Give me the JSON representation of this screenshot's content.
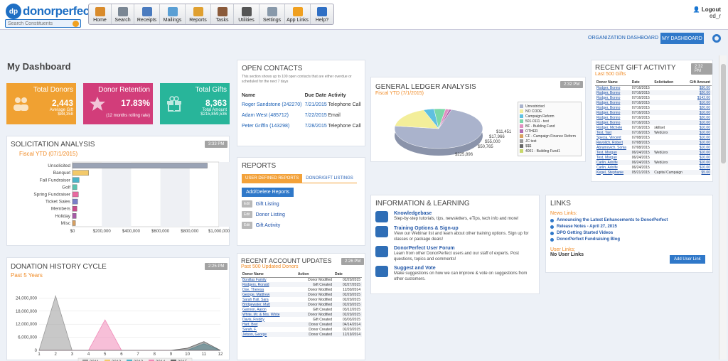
{
  "app": {
    "logo_badge": "dp",
    "logo_text": "donorperfect",
    "search_placeholder": "Search Constituents"
  },
  "nav": [
    {
      "label": "Home",
      "icon": "home-icon",
      "color": "#d98b2b"
    },
    {
      "label": "Search",
      "icon": "search-icon",
      "color": "#7b8794"
    },
    {
      "label": "Receipts",
      "icon": "receipts-icon",
      "color": "#4a7bbf"
    },
    {
      "label": "Mailings",
      "icon": "mailings-icon",
      "color": "#5a9fd4"
    },
    {
      "label": "Reports",
      "icon": "reports-icon",
      "color": "#e0a030"
    },
    {
      "label": "Tasks",
      "icon": "tasks-icon",
      "color": "#8a5a3a"
    },
    {
      "label": "Utilities",
      "icon": "utilities-icon",
      "color": "#555555"
    },
    {
      "label": "Settings",
      "icon": "settings-icon",
      "color": "#8899aa"
    },
    {
      "label": "App Links",
      "icon": "app-links-icon",
      "color": "#f0a020"
    },
    {
      "label": "Help?",
      "icon": "help-icon",
      "color": "#2f6fc4"
    }
  ],
  "user": {
    "logout": "Logout",
    "name": "ed_r"
  },
  "header": {
    "org_dashboard": "ORGANIZATION DASHBOARD",
    "my_dashboard": "MY DASHBOARD",
    "title": "My Dashboard"
  },
  "kpis": [
    {
      "title": "Total Donors",
      "value": "2,443",
      "sub1": "Average Gift",
      "sub2": "$88,358",
      "color": "#f0a132"
    },
    {
      "title": "Donor Retention",
      "value": "17.83%",
      "sub1": "(12 months rolling rate)",
      "sub2": "",
      "color": "#d23d7a"
    },
    {
      "title": "Total Gifts",
      "value": "8,363",
      "sub1": "Total Amount",
      "sub2": "$215,859,536",
      "color": "#28b59a"
    }
  ],
  "solicitation": {
    "title": "SOLICITATION ANALYSIS",
    "subtitle": "Fiscal YTD (07/1/2015)",
    "time": "3:33 PM"
  },
  "donation_history": {
    "title": "DONATION HISTORY CYCLE",
    "subtitle": "Past 5 Years",
    "time": "2:25 PM"
  },
  "open_contacts": {
    "title": "OPEN CONTACTS",
    "desc": "This section shows up to 100 open contacts that are either overdue or scheduled for the next 7 days",
    "headers": [
      "Name",
      "Due Date",
      "Activity"
    ],
    "rows": [
      {
        "name": "Roger Sandstone (242270)",
        "due": "7/21/2015",
        "activity": "Telephone Call"
      },
      {
        "name": "Adam West (485712)",
        "due": "7/22/2015",
        "activity": "Email"
      },
      {
        "name": "Peter Griffin (143298)",
        "due": "7/28/2015",
        "activity": "Telephone Call"
      }
    ]
  },
  "reports": {
    "title": "REPORTS",
    "tab1": "USER DEFINED REPORTS",
    "tab2": "DONOR/GIFT LISTINGS",
    "button": "Add/Delete Reports",
    "edit": "Edit",
    "links": [
      "Gift Listing",
      "Donor Listing",
      "Gift Activity"
    ]
  },
  "account_updates": {
    "title": "RECENT ACCOUNT UPDATES",
    "subtitle": "Past 500 Updated Donors",
    "time": "2:26 PM",
    "headers": [
      "Donor Name",
      "Action",
      "Date"
    ],
    "rows": [
      [
        "Bonillas Family",
        "Donor Modified",
        "02/20/2015"
      ],
      [
        "Rodgers, Ronald",
        "Gift Created",
        "02/27/2015"
      ],
      [
        "Doe, Theresa",
        "Donor Modified",
        "12/30/2014"
      ],
      [
        "George, Matthew",
        "Donor Modified",
        "02/20/2015"
      ],
      [
        "Sarah Hall, Sara",
        "Donor Modified",
        "02/20/2015"
      ],
      [
        "Bridgewater, Matt",
        "Donor Modified",
        "02/20/2015"
      ],
      [
        "Gannon, Aaron",
        "Gift Created",
        "03/12/2015"
      ],
      [
        "White, Mr. & Mrs. White",
        "Donor Modified",
        "02/20/2015"
      ],
      [
        "Davis, Freddy",
        "Gift Created",
        "03/03/2015"
      ],
      [
        "Hart, Bret",
        "Donor Created",
        "04/14/2014"
      ],
      [
        "Sarah, F.",
        "Donor Created",
        "02/20/2015"
      ],
      [
        "Jetson, George",
        "Donor Created",
        "12/19/2014"
      ]
    ]
  },
  "general_ledger": {
    "title": "GENERAL LEDGER ANALYSIS",
    "subtitle": "Fiscal YTD (7/1/2015)",
    "time": "2:32 PM",
    "labels": [
      "$944,723",
      "$11,451",
      "$17,966",
      "$55,000",
      "$50,765",
      "$225,896"
    ],
    "legend": [
      "Unrestricted",
      "NO CODE",
      "Campaign Reform",
      "501-0111 - test",
      "BF - Building Fund",
      "OTHER",
      "CF - Campaign Finance Reform",
      "JC test",
      "$$$",
      "4001 - Building Fund1"
    ]
  },
  "gift_activity": {
    "title": "RECENT GIFT ACTIVITY",
    "subtitle": "Last 500 Gifts",
    "time": "2:32 PM",
    "headers": [
      "Donor Name",
      "Date",
      "Solicitation",
      "Gift Amount"
    ],
    "rows": [
      [
        "Rodger, Bonno",
        "07/16/2015",
        "",
        "$30.00"
      ],
      [
        "Rodger, Bonno",
        "07/16/2015",
        "",
        "$20.00"
      ],
      [
        "Rodger, Bonno",
        "07/16/2015",
        "",
        "$142.00"
      ],
      [
        "Rodger, Bonno",
        "07/16/2015",
        "",
        "$10.00"
      ],
      [
        "Rodger, Bonno",
        "07/16/2015",
        "",
        "$20.00"
      ],
      [
        "Rodger, Bonno",
        "07/16/2015",
        "",
        "$10.00"
      ],
      [
        "Rodger, Bonno",
        "07/16/2015",
        "",
        "$20.00"
      ],
      [
        "Rodger, Bonno",
        "07/16/2015",
        "",
        "$10.00"
      ],
      [
        "Rodger, Michele",
        "07/16/2015",
        "skillset",
        "$10.00"
      ],
      [
        "Test, Tast",
        "07/16/2015",
        "WebLinx",
        "$10.00"
      ],
      [
        "Specia, Vincent",
        "07/08/2015",
        "",
        "$10.00"
      ],
      [
        "Revolich, Robert",
        "07/08/2015",
        "",
        "$10.00"
      ],
      [
        "Abramovich, Sonia",
        "07/08/2015",
        "",
        "$10.00"
      ],
      [
        "Test, Morgan",
        "06/24/2015",
        "WebLinx",
        "$10.00"
      ],
      [
        "Test, Morgan",
        "06/24/2015",
        "",
        "$10.00"
      ],
      [
        "Carlin, Adolfe",
        "06/24/2015",
        "WebLinx",
        "$10.00"
      ],
      [
        "Carlin, Adolfe",
        "06/24/2015",
        "",
        "$10.00"
      ],
      [
        "Kegel, Stephanie",
        "05/21/2015",
        "Capital Campaign",
        "$5.00"
      ]
    ]
  },
  "info": {
    "title": "INFORMATION & LEARNING",
    "items": [
      {
        "head": "Knowledgebase",
        "desc": "Step-by-step tutorials, tips, newsletters, eTips, tech info and more!",
        "icon": "book-icon"
      },
      {
        "head": "Training Options & Sign-up",
        "desc": "View our Webinar list and learn about other training options. Sign up for classes or package deals!",
        "icon": "graduation-icon"
      },
      {
        "head": "DonorPerfect User Forum",
        "desc": "Learn from other DonorPerfect users and our staff of experts. Post questions, topics and comments!",
        "icon": "chat-icon"
      },
      {
        "head": "Suggest and Vote",
        "desc": "Make suggestions on how we can improve & vote on suggestions from other customers.",
        "icon": "lightbulb-icon"
      }
    ]
  },
  "links": {
    "title": "LINKS",
    "news_label": "News Links:",
    "news": [
      "Announcing the Latest Enhancements to DonorPerfect",
      "Release Notes - April 27, 2015",
      "DPO Getting Started Videos",
      "DonorPerfect Fundraising Blog"
    ],
    "user_label": "User Links:",
    "add_button": "Add User Link",
    "no_links": "No User Links"
  },
  "chart_data": [
    {
      "type": "bar",
      "title": "SOLICITATION ANALYSIS",
      "categories": [
        "Unsolicited",
        "Banquet",
        "Fall Fundraiser",
        "Golf",
        "Spring Fundraiser",
        "Ticket Sales",
        "Members",
        "Holiday",
        "Misc"
      ],
      "values": [
        920000,
        110000,
        45000,
        30000,
        40000,
        35000,
        30000,
        25000,
        20000
      ],
      "colors": [
        "#9aa3b5",
        "#f3c96a",
        "#4bb4c8",
        "#5ac3b0",
        "#e86aa0",
        "#7a7fc8",
        "#c84a8a",
        "#a85aa8",
        "#d8a060"
      ],
      "xticks": [
        "$0",
        "$200,000",
        "$400,000",
        "$600,000",
        "$800,000",
        "$1,000,000"
      ],
      "xlim": [
        0,
        1000000
      ]
    },
    {
      "type": "area",
      "title": "DONATION HISTORY CYCLE",
      "x": [
        1,
        2,
        3,
        4,
        5,
        6,
        7,
        8,
        9,
        10,
        11,
        12
      ],
      "yticks": [
        "0",
        "6,000,000",
        "12,000,000",
        "18,000,000",
        "24,000,000"
      ],
      "ylim": [
        0,
        30000000
      ],
      "series": [
        {
          "name": "2011",
          "color": "#9a9a9a",
          "values": [
            0,
            25000000,
            0,
            0,
            0,
            0,
            0,
            0,
            0,
            0,
            0,
            0
          ]
        },
        {
          "name": "2012",
          "color": "#f3c96a",
          "values": [
            0,
            0,
            0,
            0,
            0,
            0,
            0,
            0,
            0,
            0,
            0,
            0
          ]
        },
        {
          "name": "2013",
          "color": "#4bb4c8",
          "values": [
            0,
            0,
            0,
            0,
            0,
            0,
            0,
            0,
            0,
            0,
            3000000,
            0
          ]
        },
        {
          "name": "2014",
          "color": "#f08ab8",
          "values": [
            0,
            0,
            0,
            0,
            14000000,
            0,
            0,
            0,
            0,
            0,
            0,
            0
          ]
        },
        {
          "name": "2015",
          "color": "#666666",
          "values": [
            0,
            0,
            0,
            0,
            0,
            0,
            0,
            0,
            0,
            1000000,
            4000000,
            0
          ]
        }
      ]
    },
    {
      "type": "pie",
      "title": "GENERAL LEDGER ANALYSIS",
      "categories": [
        "Unrestricted",
        "NO CODE",
        "Campaign Reform",
        "501-0111 - test",
        "BF - Building Fund",
        "OTHER"
      ],
      "values": [
        944723,
        225896,
        50765,
        55000,
        17966,
        11451
      ],
      "colors": [
        "#aab3cc",
        "#f3ee9a",
        "#5fc0e0",
        "#7ad8a8",
        "#e090c0",
        "#b06ab0"
      ]
    }
  ]
}
